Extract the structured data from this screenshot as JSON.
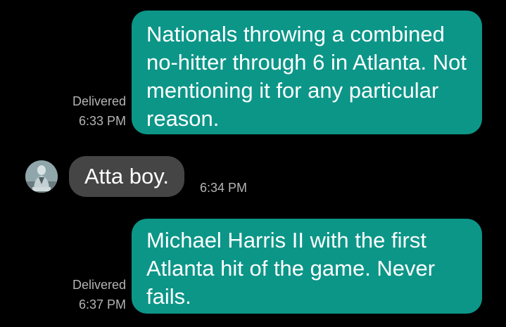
{
  "messages": [
    {
      "direction": "outgoing",
      "text": "Nationals throwing a combined no-hitter through 6 in Atlanta. Not mentioning it for any particular reason.",
      "status": "Delivered",
      "time": "6:33 PM"
    },
    {
      "direction": "incoming",
      "text": "Atta boy.",
      "time": "6:34 PM",
      "avatar_icon": "contact-photo-avatar"
    },
    {
      "direction": "outgoing",
      "text": "Michael Harris II with the first Atlanta hit of the game. Never fails.",
      "status": "Delivered",
      "time": "6:37 PM"
    }
  ],
  "colors": {
    "background": "#000000",
    "outgoing_bubble": "#0c9688",
    "incoming_bubble": "#454545",
    "message_text": "#ffffff",
    "meta_text": "#b4b4b4"
  }
}
